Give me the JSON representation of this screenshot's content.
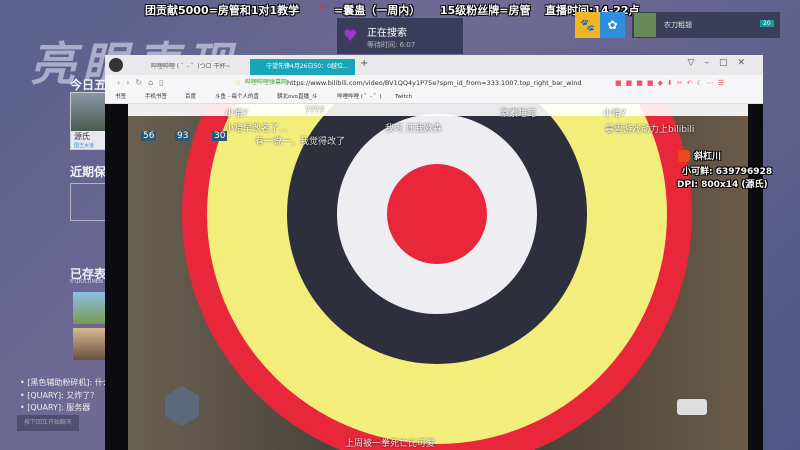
{
  "banner": {
    "text1": "团贡献5000=房管和1对1教学",
    "text2": "=鬟蛊（一周内）",
    "text3": "15级粉丝牌=房管",
    "text4": "直播时间:14-22点"
  },
  "search_overlay": {
    "status": "正在搜索",
    "wait_label": "等待时间: 6:07"
  },
  "user_card": {
    "name": "农刀粗翘",
    "badge": "20"
  },
  "left_panel": {
    "big_title": "亮眼表现",
    "today": "今日五",
    "hero_name": "源氏",
    "hero_sub": "国王大道",
    "recent": "近期保",
    "saved": "已存表",
    "path": "E:\\DOCUMEN",
    "chat": [
      "• [黑色辅助粉碎机]: 什么那",
      "• [QUARY]: 又炸了？",
      "• [QUARY]: 服务器"
    ],
    "chat_button": "按下回车开始聊天"
  },
  "browser": {
    "tabs": [
      "哔哩哔哩 ( ゜- ゜)つロ 干杯~-bilibili",
      "守望先锋4月26日50：0越位..."
    ],
    "url_site": "哔哩哔哩弹幕网",
    "url": "https://www.bilibili.com/video/BV1QQ4y1P75e?spm_id_from=333.1007.top_right_bar_wind",
    "bookmarks": [
      "书签",
      "手机书签",
      "百度",
      "斗鱼 - 每个人的直",
      "朝北ovo直播_斗",
      "哔哩哔哩 ( ゜- ゜)",
      "Twitch"
    ]
  },
  "video": {
    "danmaku": [
      "小哈?",
      "????",
      "激素睡宠",
      "小哈?",
      "小哈早改名了...",
      "我可 还我欧森",
      "有一说一，我觉得改了",
      "暴雪游戏动力上bilibili",
      "上周被一拳死亡比可爱"
    ],
    "hud": [
      "56",
      "93",
      "30"
    ],
    "right_info": {
      "line1": "斜杠川",
      "line2": "小可鲜: 639796928",
      "line3": "DPI: 800x14 (源氏)"
    }
  },
  "colors": {
    "red": "#e8273a",
    "yellow": "#f3ee7b",
    "dark": "#2d2f3d",
    "light": "#eeeef2"
  }
}
